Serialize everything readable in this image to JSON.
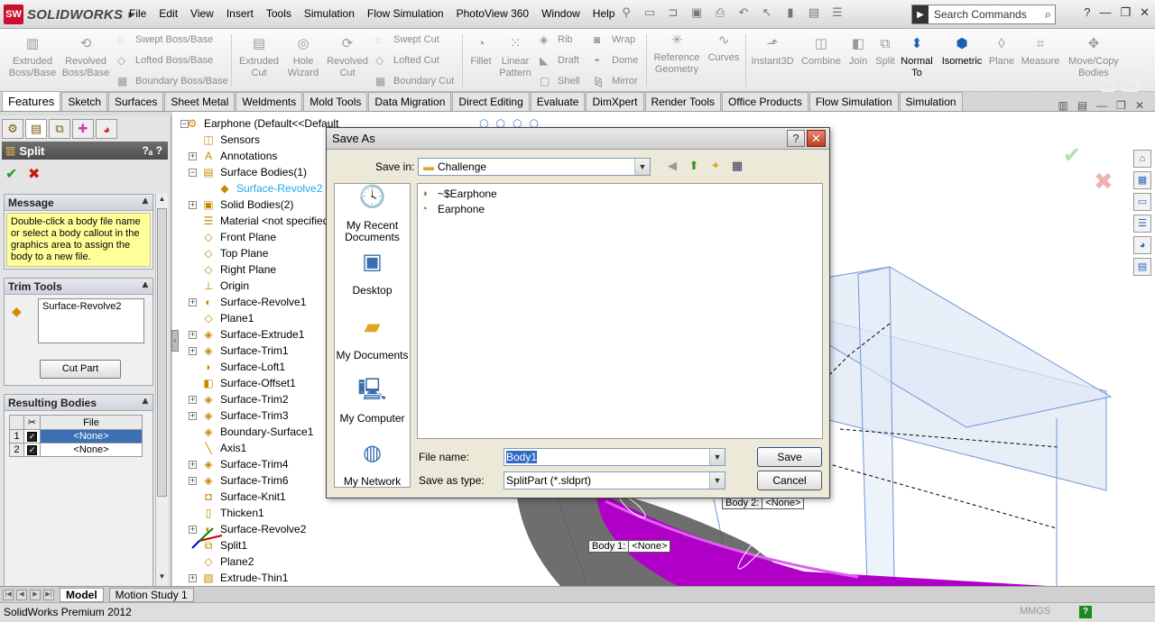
{
  "app": {
    "logo_text": "SOLIDWORKS",
    "menus": [
      "File",
      "Edit",
      "View",
      "Insert",
      "Tools",
      "Simulation",
      "Flow Simulation",
      "PhotoView 360",
      "Window",
      "Help"
    ],
    "search_placeholder": "Search Commands"
  },
  "ribbon": {
    "big_buttons": [
      {
        "label": "Extruded Boss/Base",
        "icon": "extrude-icon",
        "enabled": false
      },
      {
        "label": "Revolved Boss/Base",
        "icon": "revolve-icon",
        "enabled": false
      },
      {
        "label": "Extruded Cut",
        "icon": "extruded-cut-icon",
        "enabled": false
      },
      {
        "label": "Hole Wizard",
        "icon": "hole-wizard-icon",
        "enabled": false
      },
      {
        "label": "Revolved Cut",
        "icon": "revolved-cut-icon",
        "enabled": false
      },
      {
        "label": "Fillet",
        "icon": "fillet-icon",
        "enabled": false
      },
      {
        "label": "Linear Pattern",
        "icon": "linear-pattern-icon",
        "enabled": false
      },
      {
        "label": "Reference Geometry",
        "icon": "reference-geometry-icon",
        "enabled": false
      },
      {
        "label": "Curves",
        "icon": "curves-icon",
        "enabled": false
      },
      {
        "label": "Instant3D",
        "icon": "instant3d-icon",
        "enabled": false
      },
      {
        "label": "Combine",
        "icon": "combine-icon",
        "enabled": false
      },
      {
        "label": "Join",
        "icon": "join-icon",
        "enabled": false
      },
      {
        "label": "Split",
        "icon": "split-icon",
        "enabled": false
      },
      {
        "label": "Normal To",
        "icon": "normal-to-icon",
        "enabled": true
      },
      {
        "label": "Isometric",
        "icon": "isometric-icon",
        "enabled": true
      },
      {
        "label": "Plane",
        "icon": "plane-icon",
        "enabled": false
      },
      {
        "label": "Measure",
        "icon": "measure-icon",
        "enabled": false
      },
      {
        "label": "Move/Copy Bodies",
        "icon": "move-copy-icon",
        "enabled": false
      }
    ],
    "small_col1": [
      "Swept Boss/Base",
      "Lofted Boss/Base",
      "Boundary Boss/Base"
    ],
    "small_col2": [
      "Swept Cut",
      "Lofted Cut",
      "Boundary Cut"
    ],
    "small_col3": [
      "Rib",
      "Draft",
      "Shell"
    ],
    "small_col4": [
      "Wrap",
      "Dome",
      "Mirror"
    ]
  },
  "tabs": [
    "Features",
    "Sketch",
    "Surfaces",
    "Sheet Metal",
    "Weldments",
    "Mold Tools",
    "Data Migration",
    "Direct Editing",
    "Evaluate",
    "DimXpert",
    "Render Tools",
    "Office Products",
    "Flow Simulation",
    "Simulation"
  ],
  "property_manager": {
    "title": "Split",
    "message_header": "Message",
    "message": "Double-click a body file name or select a body callout in the graphics area to assign the body to a new file.",
    "trim_header": "Trim Tools",
    "trim_item": "Surface-Revolve2",
    "cut_button": "Cut Part",
    "results_header": "Resulting Bodies",
    "results_col": "File",
    "results_rows": [
      {
        "num": "1",
        "file": "<None>"
      },
      {
        "num": "2",
        "file": "<None>"
      }
    ]
  },
  "tree": [
    {
      "label": "Earphone  (Default<<Default",
      "icon": "part-icon"
    },
    {
      "label": "Sensors",
      "icon": "sensors-icon"
    },
    {
      "label": "Annotations",
      "icon": "annotations-icon"
    },
    {
      "label": "Surface Bodies(1)",
      "icon": "surface-bodies-icon"
    },
    {
      "label": "Surface-Revolve2",
      "icon": "surface-icon"
    },
    {
      "label": "Solid Bodies(2)",
      "icon": "solid-bodies-icon"
    },
    {
      "label": "Material <not specified>",
      "icon": "material-icon"
    },
    {
      "label": "Front Plane",
      "icon": "plane-icon"
    },
    {
      "label": "Top Plane",
      "icon": "plane-icon"
    },
    {
      "label": "Right Plane",
      "icon": "plane-icon"
    },
    {
      "label": "Origin",
      "icon": "origin-icon"
    },
    {
      "label": "Surface-Revolve1",
      "icon": "surface-revolve-icon"
    },
    {
      "label": "Plane1",
      "icon": "plane-icon"
    },
    {
      "label": "Surface-Extrude1",
      "icon": "surface-extrude-icon"
    },
    {
      "label": "Surface-Trim1",
      "icon": "surface-trim-icon"
    },
    {
      "label": "Surface-Loft1",
      "icon": "surface-loft-icon"
    },
    {
      "label": "Surface-Offset1",
      "icon": "surface-offset-icon"
    },
    {
      "label": "Surface-Trim2",
      "icon": "surface-trim-icon"
    },
    {
      "label": "Surface-Trim3",
      "icon": "surface-trim-icon"
    },
    {
      "label": "Boundary-Surface1",
      "icon": "boundary-surface-icon"
    },
    {
      "label": "Axis1",
      "icon": "axis-icon"
    },
    {
      "label": "Surface-Trim4",
      "icon": "surface-trim-icon"
    },
    {
      "label": "Surface-Trim6",
      "icon": "surface-trim-icon"
    },
    {
      "label": "Surface-Knit1",
      "icon": "surface-knit-icon"
    },
    {
      "label": "Thicken1",
      "icon": "thicken-icon"
    },
    {
      "label": "Surface-Revolve2",
      "icon": "surface-revolve-icon"
    },
    {
      "label": "Split1",
      "icon": "split-icon"
    },
    {
      "label": "Plane2",
      "icon": "plane-icon"
    },
    {
      "label": "Extrude-Thin1",
      "icon": "extrude-thin-icon"
    }
  ],
  "callouts": {
    "body1_label": "Body  1:",
    "body1_value": "<None>",
    "body2_label": "Body  2:",
    "body2_value": "<None>"
  },
  "dialog": {
    "title": "Save As",
    "save_in_label": "Save in:",
    "save_in_value": "Challenge",
    "places": [
      "My Recent Documents",
      "Desktop",
      "My Documents",
      "My Computer",
      "My Network"
    ],
    "files": [
      {
        "name": "~$Earphone",
        "icon": "locked-part-icon"
      },
      {
        "name": "Earphone",
        "icon": "part-file-icon"
      }
    ],
    "file_name_label": "File name:",
    "file_name_value": "Body1",
    "save_as_type_label": "Save as type:",
    "save_as_type_value": "SplitPart (*.sldprt)",
    "save_button": "Save",
    "cancel_button": "Cancel"
  },
  "bottom_tabs": [
    "Model",
    "Motion Study 1"
  ],
  "status": {
    "text": "SolidWorks Premium 2012",
    "units": "MMGS"
  },
  "colors": {
    "magenta_body": "#b000c8",
    "highlight": "#1ea9e8",
    "selection": "#3c6fb4"
  }
}
